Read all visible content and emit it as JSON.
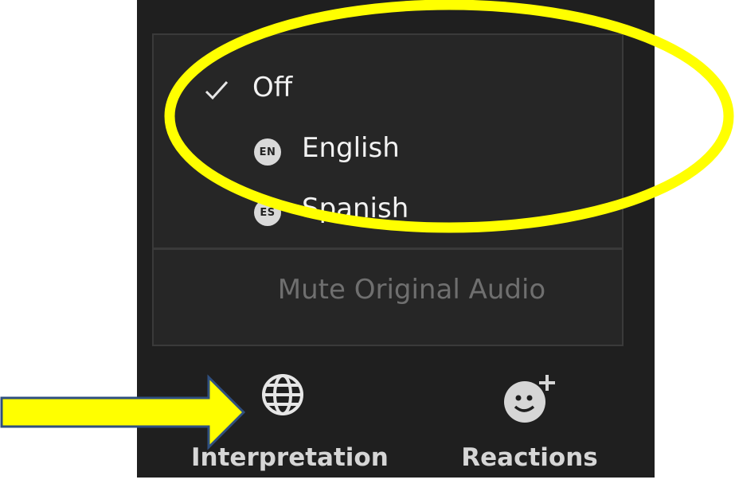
{
  "menu": {
    "items": [
      {
        "label": "Off",
        "checked": true
      },
      {
        "label": "English",
        "badge": "EN",
        "checked": false
      },
      {
        "label": "Spanish",
        "badge": "ES",
        "checked": false
      }
    ],
    "mute_label": "Mute Original Audio"
  },
  "toolbar": {
    "interpretation_label": "Interpretation",
    "reactions_label": "Reactions"
  },
  "annotation_colors": {
    "highlight": "#ffff00",
    "arrow_fill": "#ffff00",
    "arrow_outline": "#2f4f7f"
  },
  "icons": [
    "check-icon",
    "globe-icon",
    "emoji-add-icon",
    "arrow-annotation"
  ]
}
